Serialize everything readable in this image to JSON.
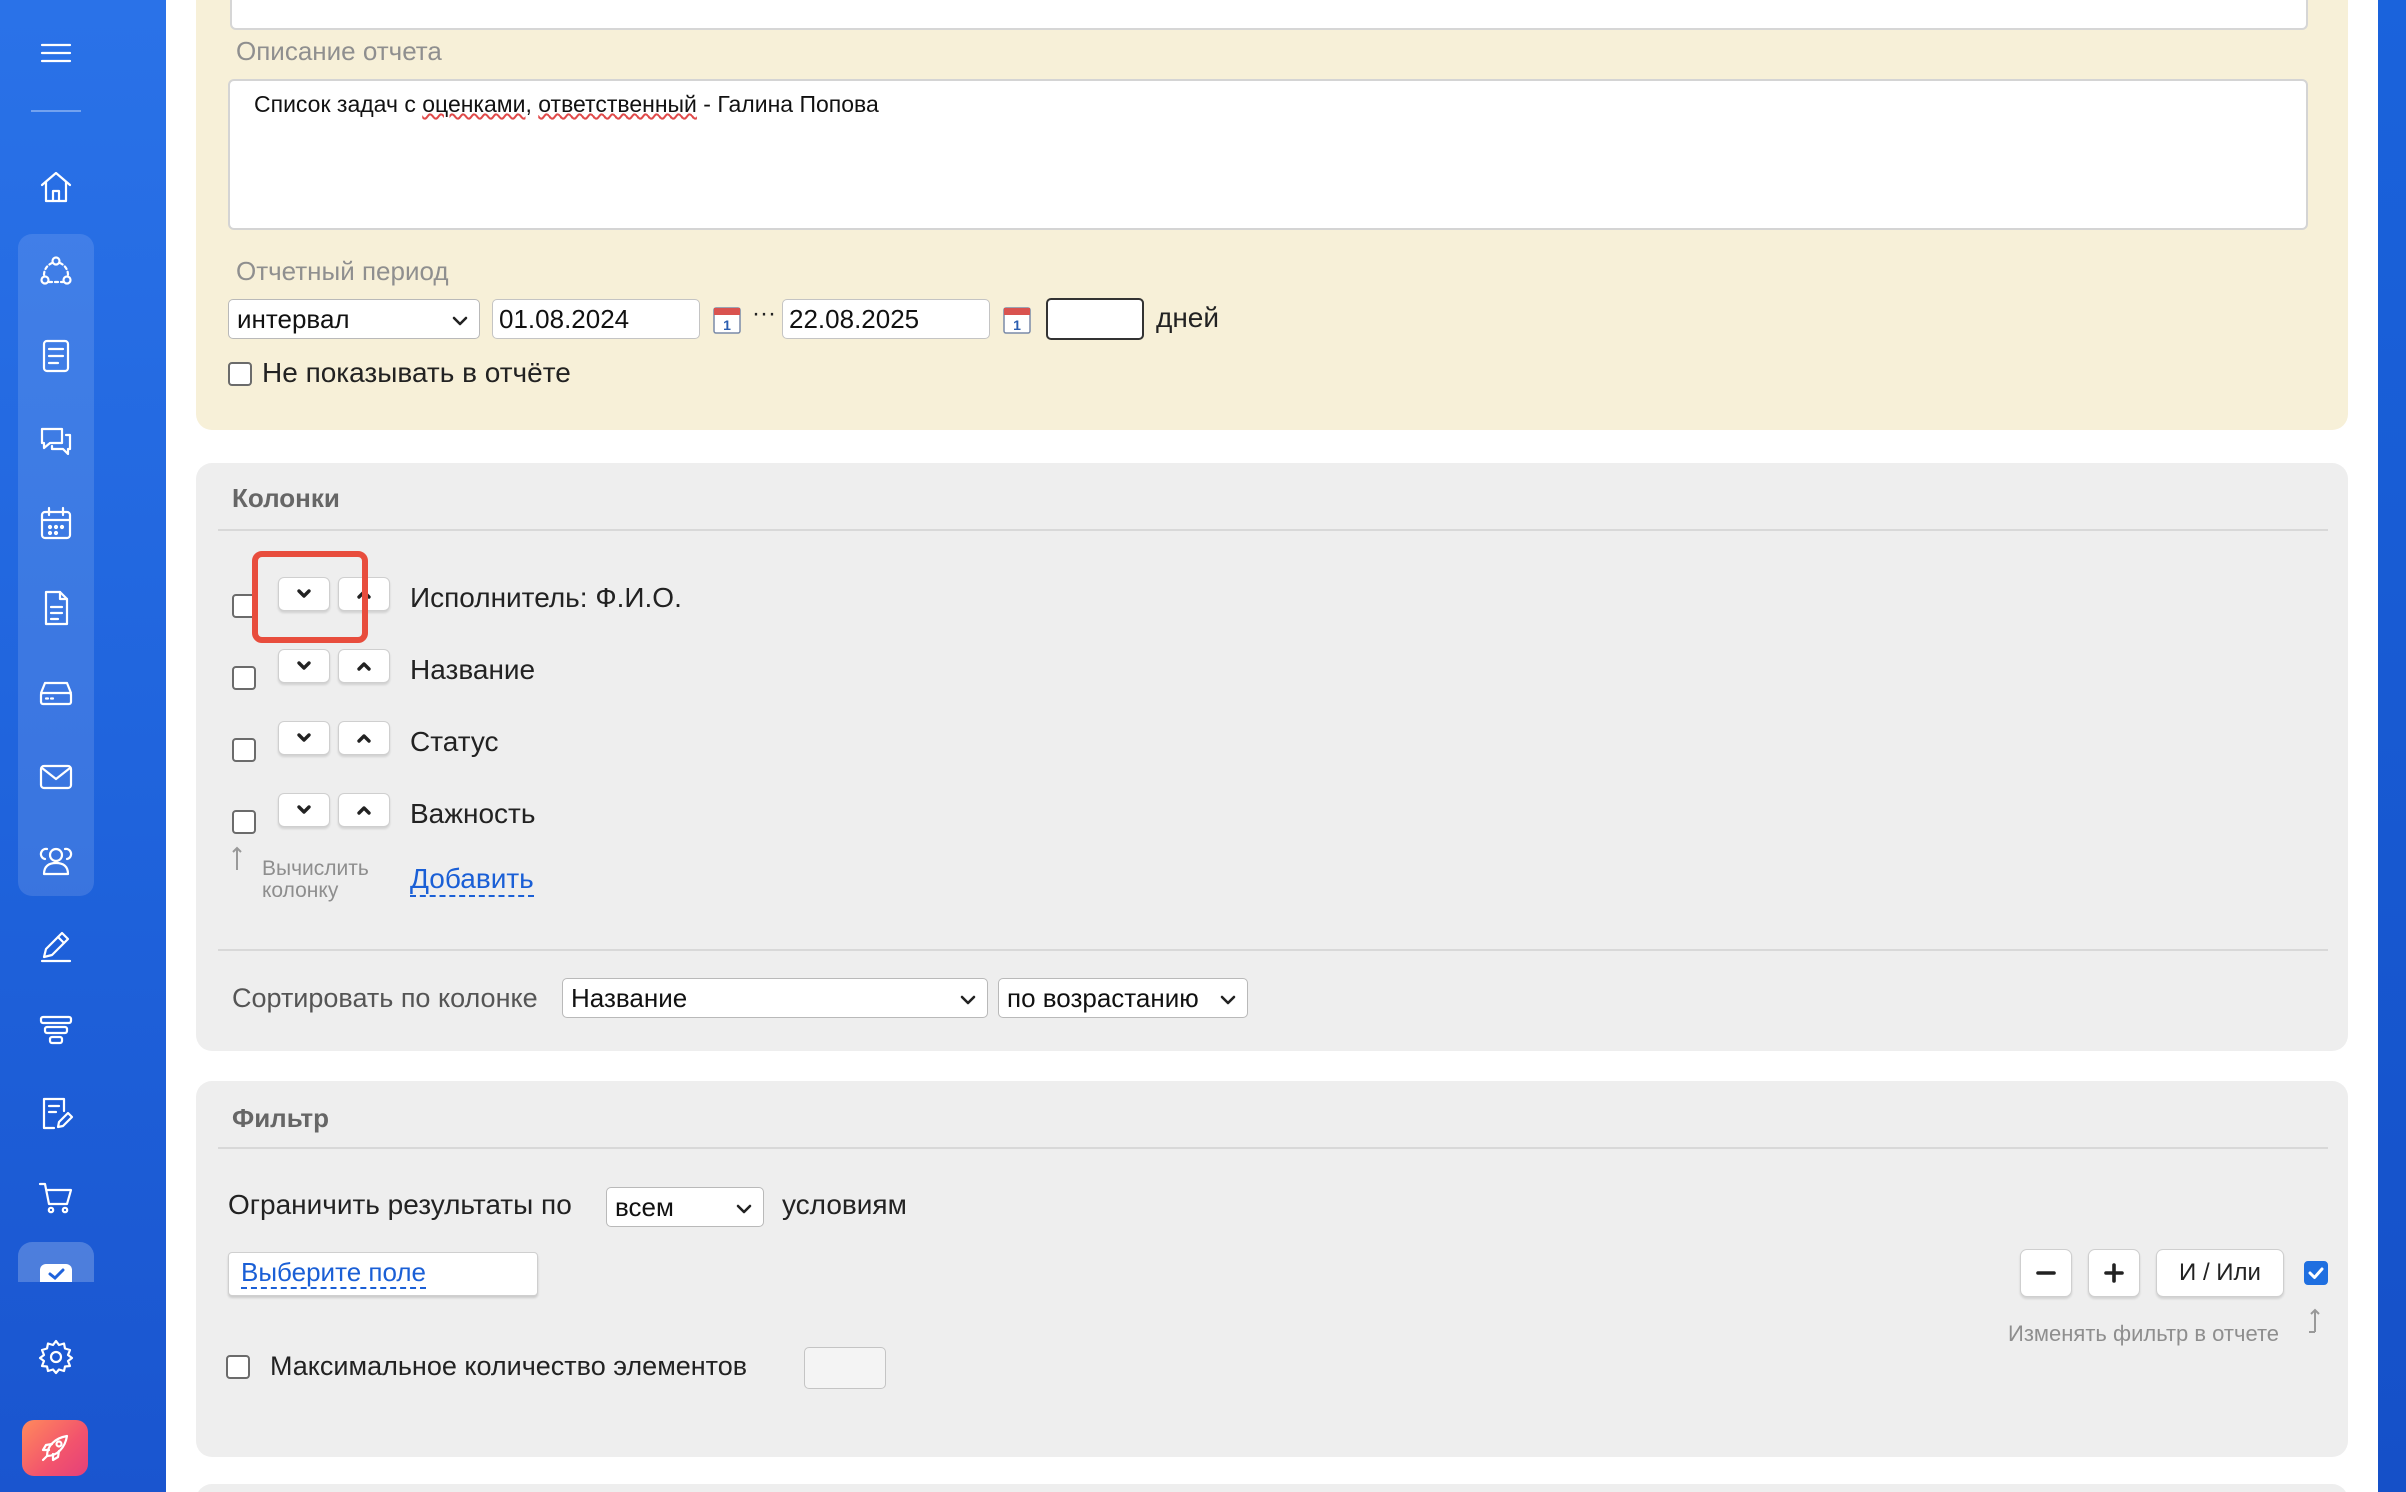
{
  "sidebar": {
    "items": [
      {
        "name": "menu-icon"
      },
      {
        "name": "home-icon"
      },
      {
        "name": "workflow-icon"
      },
      {
        "name": "tasks-icon"
      },
      {
        "name": "chat-icon"
      },
      {
        "name": "calendar-icon"
      },
      {
        "name": "document-icon"
      },
      {
        "name": "storage-icon"
      },
      {
        "name": "mail-icon"
      },
      {
        "name": "contacts-icon"
      },
      {
        "name": "pen-icon"
      },
      {
        "name": "filter-stack-icon"
      },
      {
        "name": "edit-document-icon"
      },
      {
        "name": "cart-icon"
      },
      {
        "name": "checkbox-icon"
      },
      {
        "name": "settings-icon"
      },
      {
        "name": "rocket-icon"
      }
    ]
  },
  "report": {
    "description_label": "Описание отчета",
    "description_value_part1": "Список задач с ",
    "description_value_word1": "оценками",
    "description_value_part2": ", ",
    "description_value_word2": "ответственный",
    "description_value_part3": " - Галина Попова",
    "period_label": "Отчетный период",
    "period_type": "интервал",
    "date_from": "01.08.2024",
    "range_sep": "···",
    "date_to": "22.08.2025",
    "days_value": "",
    "days_label": "дней",
    "hide_in_report_label": "Не показывать в отчёте"
  },
  "columns": {
    "title": "Колонки",
    "items": [
      {
        "label": "Исполнитель: Ф.И.О."
      },
      {
        "label": "Название"
      },
      {
        "label": "Статус"
      },
      {
        "label": "Важность"
      }
    ],
    "compute_label_line1": "Вычислить",
    "compute_label_line2": "колонку",
    "add_link": "Добавить",
    "sort_label": "Сортировать по колонке",
    "sort_column": "Название",
    "sort_order": "по возрастанию"
  },
  "filter": {
    "title": "Фильтр",
    "limit_prefix": "Ограничить результаты по",
    "limit_mode": "всем",
    "limit_suffix": "условиям",
    "choose_field": "Выберите поле",
    "and_or_label": "И / Или",
    "change_in_report_label": "Изменять фильтр в отчете",
    "max_items_label": "Максимальное количество элементов",
    "max_items_value": ""
  },
  "colors": {
    "accent": "#1f6fe0",
    "highlight": "#e84d3d",
    "top_panel": "#f7f0d8",
    "section_panel": "#eeeeee"
  }
}
